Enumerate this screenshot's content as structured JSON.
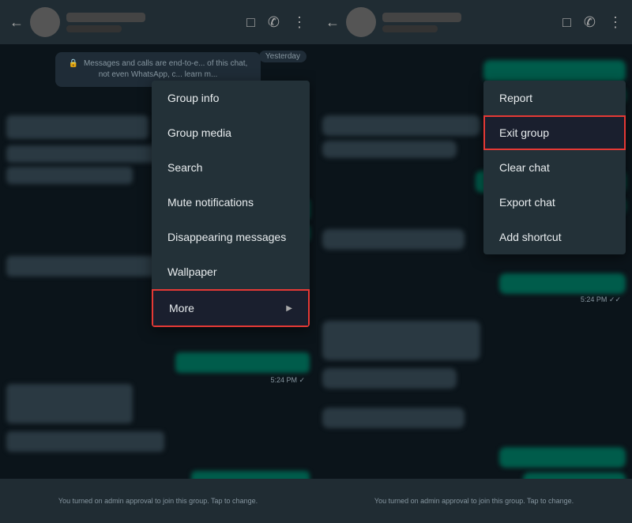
{
  "left_panel": {
    "top_bar": {
      "back_label": "←",
      "video_icon": "📹",
      "phone_icon": "📞",
      "more_icon": "⋮"
    },
    "date_badge": "Yesterday",
    "security_notice": "Messages and calls are end-to-e... of this chat, not even WhatsApp, c... learn m...",
    "dropdown": {
      "items": [
        {
          "id": "group-info",
          "label": "Group info",
          "arrow": ""
        },
        {
          "id": "group-media",
          "label": "Group media",
          "arrow": ""
        },
        {
          "id": "search",
          "label": "Search",
          "arrow": ""
        },
        {
          "id": "mute-notifications",
          "label": "Mute notifications",
          "arrow": ""
        },
        {
          "id": "disappearing-messages",
          "label": "Disappearing messages",
          "arrow": ""
        },
        {
          "id": "wallpaper",
          "label": "Wallpaper",
          "arrow": ""
        },
        {
          "id": "more",
          "label": "More",
          "arrow": "▶",
          "highlighted": true
        }
      ]
    },
    "bottom_notice": "You turned on admin approval to join this group. Tap to change."
  },
  "right_panel": {
    "top_bar": {
      "back_label": "←",
      "video_icon": "📹",
      "phone_icon": "📞",
      "more_icon": "⋮"
    },
    "dropdown": {
      "items": [
        {
          "id": "report",
          "label": "Report",
          "highlighted": false
        },
        {
          "id": "exit-group",
          "label": "Exit group",
          "highlighted": true
        },
        {
          "id": "clear-chat",
          "label": "Clear chat",
          "highlighted": false
        },
        {
          "id": "export-chat",
          "label": "Export chat",
          "highlighted": false
        },
        {
          "id": "add-shortcut",
          "label": "Add shortcut",
          "highlighted": false
        }
      ]
    },
    "bottom_notice": "You turned on admin approval to join this group. Tap to change."
  },
  "icons": {
    "video": "▶",
    "phone": "✆",
    "more": "⋮",
    "back": "←",
    "arrow_right": "▶",
    "lock": "🔒"
  }
}
